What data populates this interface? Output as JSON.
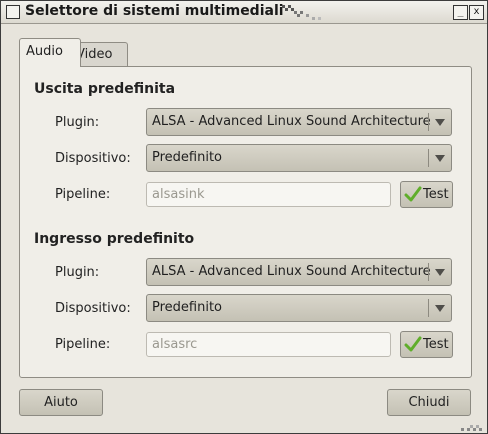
{
  "window": {
    "title": "Selettore di sistemi multimediali",
    "minimize_glyph": "_",
    "close_glyph": "x"
  },
  "tabs": [
    {
      "label": "Audio",
      "active": true
    },
    {
      "label": "Video",
      "active": false
    }
  ],
  "output": {
    "heading": "Uscita predefinita",
    "plugin_label": "Plugin:",
    "plugin_value": "ALSA - Advanced Linux Sound Architecture",
    "device_label": "Dispositivo:",
    "device_value": "Predefinito",
    "pipeline_label": "Pipeline:",
    "pipeline_value": "alsasink",
    "test_label": "Test"
  },
  "input": {
    "heading": "Ingresso predefinito",
    "plugin_label": "Plugin:",
    "plugin_value": "ALSA - Advanced Linux Sound Architecture",
    "device_label": "Dispositivo:",
    "device_value": "Predefinito",
    "pipeline_label": "Pipeline:",
    "pipeline_value": "alsasrc",
    "test_label": "Test"
  },
  "buttons": {
    "help": "Aiuto",
    "close": "Chiudi"
  },
  "icons": {
    "check": "check-icon",
    "dropdown": "chevron-down-icon",
    "colors": {
      "check_green": "#5fae2a"
    }
  }
}
